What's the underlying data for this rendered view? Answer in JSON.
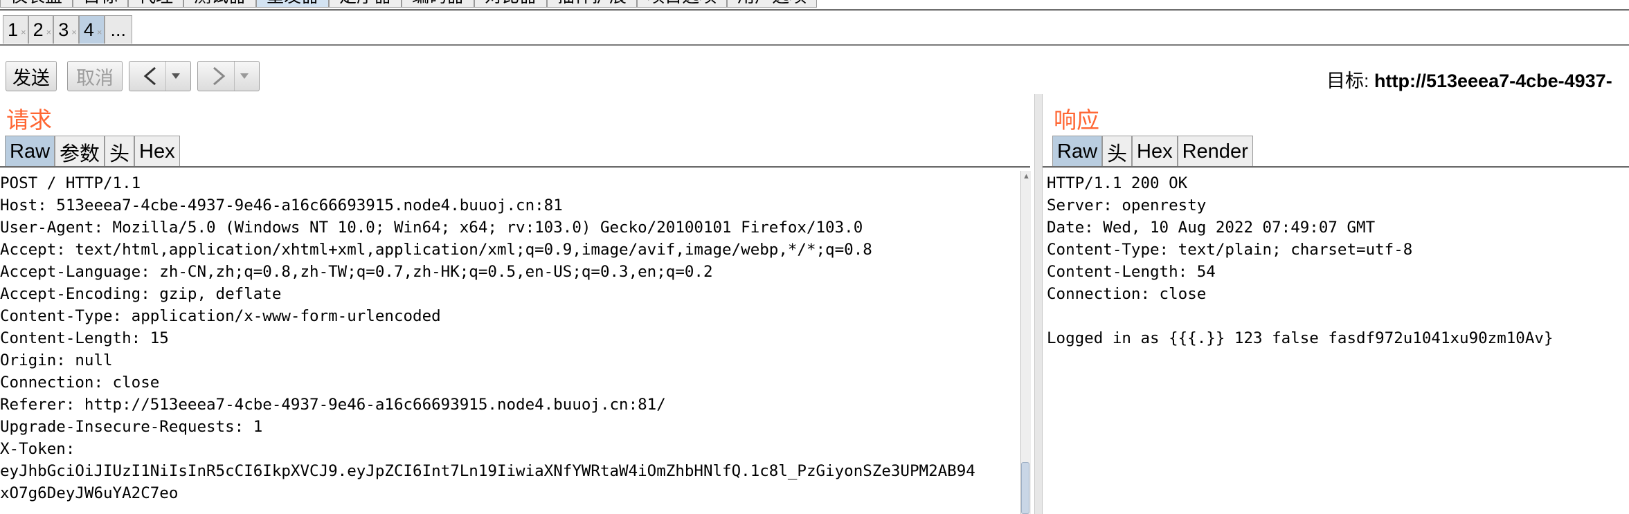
{
  "main_tabs": [
    {
      "label": "仪表盘",
      "active": false
    },
    {
      "label": "目标",
      "active": false
    },
    {
      "label": "代理",
      "active": false
    },
    {
      "label": "测试器",
      "active": false
    },
    {
      "label": "重发器",
      "active": true
    },
    {
      "label": "定序器",
      "active": false
    },
    {
      "label": "编码器",
      "active": false
    },
    {
      "label": "对比器",
      "active": false
    },
    {
      "label": "插件扩展",
      "active": false
    },
    {
      "label": "项目选项",
      "active": false
    },
    {
      "label": "用户选项",
      "active": false
    }
  ],
  "sub_tabs": [
    {
      "label": "1",
      "close": "×",
      "active": false
    },
    {
      "label": "2",
      "close": "×",
      "active": false
    },
    {
      "label": "3",
      "close": "×",
      "active": false
    },
    {
      "label": "4",
      "close": "×",
      "active": true
    },
    {
      "label": "...",
      "close": "",
      "active": false
    }
  ],
  "toolbar": {
    "send_label": "发送",
    "cancel_label": "取消",
    "back_icon": "‹",
    "forward_icon": "›",
    "dropdown_icon": "▾",
    "target_prefix": "目标: ",
    "target_url": "http://513eeea7-4cbe-4937-"
  },
  "request": {
    "title": "请求",
    "tabs": [
      "Raw",
      "参数",
      "头",
      "Hex"
    ],
    "lines": [
      "POST / HTTP/1.1",
      "Host: 513eeea7-4cbe-4937-9e46-a16c66693915.node4.buuoj.cn:81",
      "User-Agent: Mozilla/5.0 (Windows NT 10.0; Win64; x64; rv:103.0) Gecko/20100101 Firefox/103.0",
      "Accept: text/html,application/xhtml+xml,application/xml;q=0.9,image/avif,image/webp,*/*;q=0.8",
      "Accept-Language: zh-CN,zh;q=0.8,zh-TW;q=0.7,zh-HK;q=0.5,en-US;q=0.3,en;q=0.2",
      "Accept-Encoding: gzip, deflate",
      "Content-Type: application/x-www-form-urlencoded",
      "Content-Length: 15",
      "Origin: null",
      "Connection: close",
      "Referer: http://513eeea7-4cbe-4937-9e46-a16c66693915.node4.buuoj.cn:81/",
      "Upgrade-Insecure-Requests: 1",
      "X-Token:",
      "eyJhbGciOiJIUzI1NiIsInR5cCI6IkpXVCJ9.eyJpZCI6Int7Ln19IiwiaXNfYWRtaW4iOmZhbHNlfQ.1c8l_PzGiyonSZe3UPM2AB94",
      "xO7g6DeyJW6uYA2C7eo"
    ]
  },
  "response": {
    "title": "响应",
    "tabs": [
      "Raw",
      "头",
      "Hex",
      "Render"
    ],
    "lines": [
      "HTTP/1.1 200 OK",
      "Server: openresty",
      "Date: Wed, 10 Aug 2022 07:49:07 GMT",
      "Content-Type: text/plain; charset=utf-8",
      "Content-Length: 54",
      "Connection: close",
      "",
      "Logged in as {{{.}} 123 false fasdf972u1041xu90zm10Av}"
    ]
  }
}
